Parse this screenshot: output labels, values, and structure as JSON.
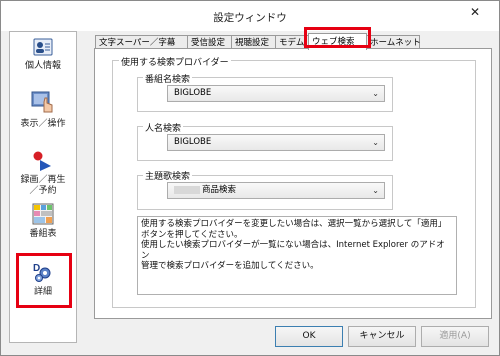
{
  "window": {
    "title": "設定ウィンドウ",
    "close_symbol": "✕"
  },
  "sidebar": {
    "items": [
      {
        "label": "個人情報",
        "icon": "contact-card-icon"
      },
      {
        "label": "表示／操作",
        "icon": "hand-pointer-icon"
      },
      {
        "label": "録画／再生\n／予約",
        "icon": "record-play-icon"
      },
      {
        "label": "番組表",
        "icon": "program-grid-icon"
      },
      {
        "label": "詳細",
        "icon": "details-gears-icon"
      }
    ]
  },
  "tabs": [
    {
      "label": "文字スーパー／字幕"
    },
    {
      "label": "受信設定"
    },
    {
      "label": "視聴設定"
    },
    {
      "label": "モデム"
    },
    {
      "label": "ウェブ検索",
      "active": true
    },
    {
      "label": "ホームネット"
    }
  ],
  "panel": {
    "group_title": "使用する検索プロバイダー",
    "fields": [
      {
        "label": "番組名検索",
        "value": "BIGLOBE"
      },
      {
        "label": "人名検索",
        "value": "BIGLOBE"
      },
      {
        "label": "主題歌検索",
        "value": "商品検索"
      }
    ],
    "note_lines": [
      "使用する検索プロバイダーを変更したい場合は、選択一覧から選択して「適用」",
      "ボタンを押してください。",
      "使用したい検索プロバイダーが一覧にない場合は、Internet Explorer のアドオン",
      "管理で検索プロバイダーを追加してください。"
    ]
  },
  "buttons": {
    "ok": "OK",
    "cancel": "キャンセル",
    "apply": "適用(A)"
  },
  "colors": {
    "highlight": "#e60012",
    "window_bg": "#f0f0f0"
  }
}
